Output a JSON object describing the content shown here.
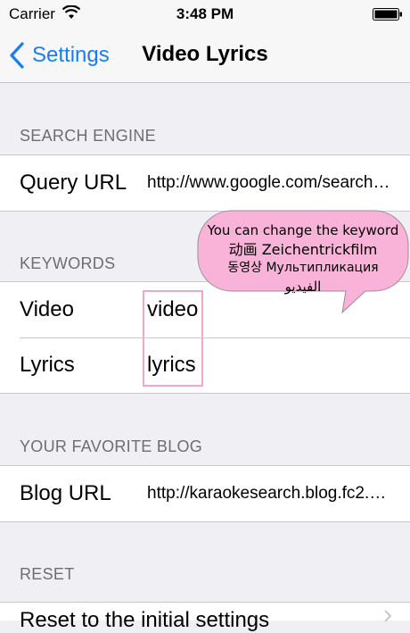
{
  "status_bar": {
    "carrier": "Carrier",
    "time": "3:48 PM",
    "wifi_icon": "wifi-icon",
    "battery_icon": "battery-icon"
  },
  "nav": {
    "back_label": "Settings",
    "title": "Video Lyrics",
    "accent_color": "#1a7cf4"
  },
  "sections": {
    "search_engine": {
      "header": "SEARCH ENGINE",
      "rows": [
        {
          "label": "Query URL",
          "value": "http://www.google.com/search?q="
        }
      ]
    },
    "keywords": {
      "header": "KEYWORDS",
      "rows": [
        {
          "label": "Video",
          "value": "video"
        },
        {
          "label": "Lyrics",
          "value": "lyrics"
        }
      ]
    },
    "favorite_blog": {
      "header": "YOUR FAVORITE BLOG",
      "rows": [
        {
          "label": "Blog URL",
          "value": "http://karaokesearch.blog.fc2.com"
        }
      ]
    },
    "reset": {
      "header": "RESET",
      "row_label": "Reset to the initial settings"
    }
  },
  "callout": {
    "lines": [
      "You can change the keyword",
      "动画 Zeichentrickfilm",
      "동영상 Мультипликация",
      "الفيديو"
    ],
    "bubble_color": "#f9b2d8",
    "box_color": "#f2a6cc"
  }
}
